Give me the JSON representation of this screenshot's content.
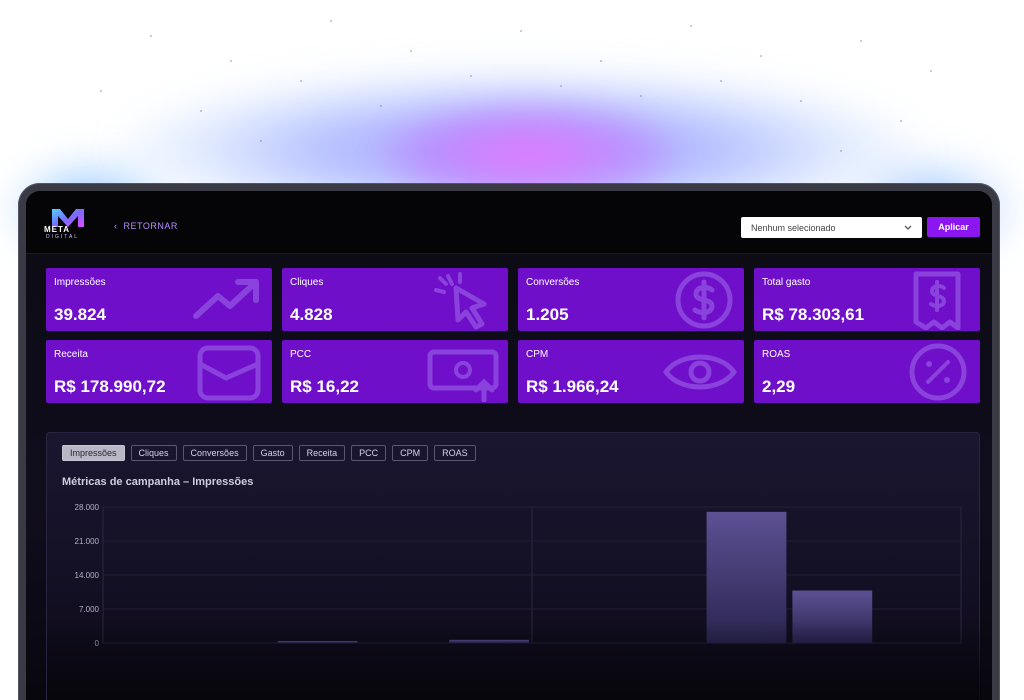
{
  "header": {
    "logo_text": "META",
    "logo_subtext": "DIGITAL",
    "back_label": "RETORNAR",
    "select": {
      "value": "Nenhum selecionado"
    },
    "apply_label": "Aplicar"
  },
  "cards": [
    {
      "label": "Impressões",
      "value": "39.824",
      "icon": "trending-up-icon"
    },
    {
      "label": "Cliques",
      "value": "4.828",
      "icon": "cursor-click-icon"
    },
    {
      "label": "Conversões",
      "value": "1.205",
      "icon": "dollar-circle-icon"
    },
    {
      "label": "Total gasto",
      "value": "R$ 78.303,61",
      "icon": "receipt-icon"
    },
    {
      "label": "Receita",
      "value": "R$ 178.990,72",
      "icon": "wallet-icon"
    },
    {
      "label": "PCC",
      "value": "R$ 16,22",
      "icon": "cash-upload-icon"
    },
    {
      "label": "CPM",
      "value": "R$ 1.966,24",
      "icon": "eye-icon"
    },
    {
      "label": "ROAS",
      "value": "2,29",
      "icon": "percent-circle-icon"
    }
  ],
  "tabs": [
    "Impressões",
    "Cliques",
    "Conversões",
    "Gasto",
    "Receita",
    "PCC",
    "CPM",
    "ROAS"
  ],
  "active_tab": "Impressões",
  "chart_title": "Métricas de campanha – Impressões",
  "colors": {
    "accent": "#8b16f0",
    "card": "#6f0fc9",
    "link": "#b58cff"
  },
  "chart_data": {
    "type": "bar",
    "ylim": [
      0,
      28000
    ],
    "yticks": [
      "28.000",
      "21.000",
      "14.000",
      "7.000",
      "0"
    ],
    "values": [
      0,
      0,
      400,
      0,
      650,
      0,
      0,
      27000,
      10800,
      0
    ],
    "title": "Métricas de campanha – Impressões"
  }
}
